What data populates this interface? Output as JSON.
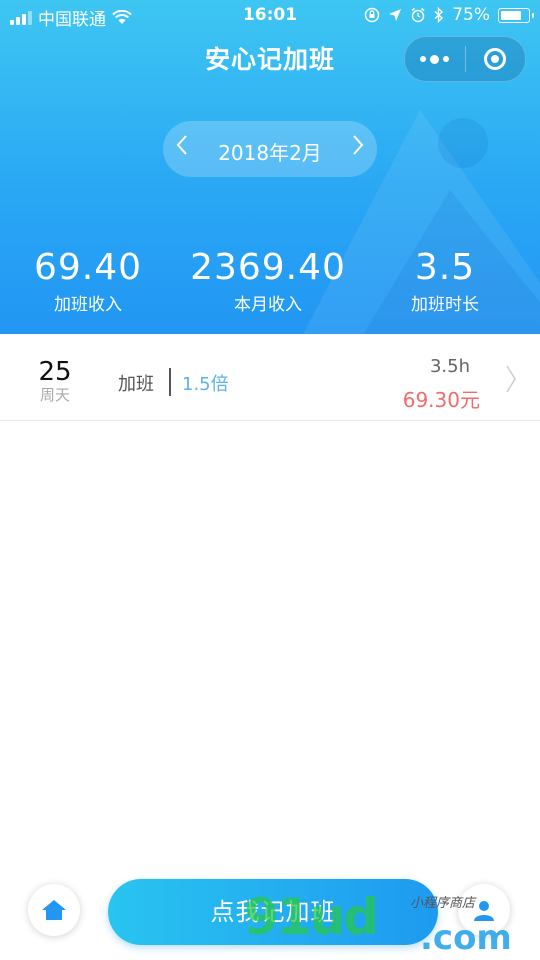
{
  "status_bar": {
    "carrier": "中国联通",
    "time": "16:01",
    "battery_pct": "75%",
    "icons": [
      "signal-icon",
      "wifi-icon",
      "rotation-lock-icon",
      "location-icon",
      "alarm-icon",
      "bluetooth-icon",
      "battery-icon"
    ]
  },
  "nav": {
    "title": "安心记加班",
    "more_icon": "more-dots-icon",
    "close_icon": "target-close-icon"
  },
  "month_picker": {
    "label": "2018年2月",
    "prev_icon": "chevron-left-icon",
    "next_icon": "chevron-right-icon"
  },
  "stats": [
    {
      "value": "69.40",
      "label": "加班收入"
    },
    {
      "value": "2369.40",
      "label": "本月收入"
    },
    {
      "value": "3.5",
      "label": "加班时长"
    }
  ],
  "records": [
    {
      "day": "25",
      "weekday": "周天",
      "type": "加班",
      "multiplier": "1.5倍",
      "hours": "3.5h",
      "pay": "69.30元"
    }
  ],
  "bottom": {
    "cta_label": "点我记加班",
    "home_icon": "home-icon",
    "profile_icon": "profile-icon"
  },
  "watermark": {
    "main": "91ud",
    "sub": ".com",
    "handwriting": "小程序商店"
  },
  "colors": {
    "header_top": "#3ec6f2",
    "header_bottom": "#2196f3",
    "multiplier": "#5ab2ec",
    "pay": "#f06b6b",
    "cta": "#1e9af0"
  }
}
